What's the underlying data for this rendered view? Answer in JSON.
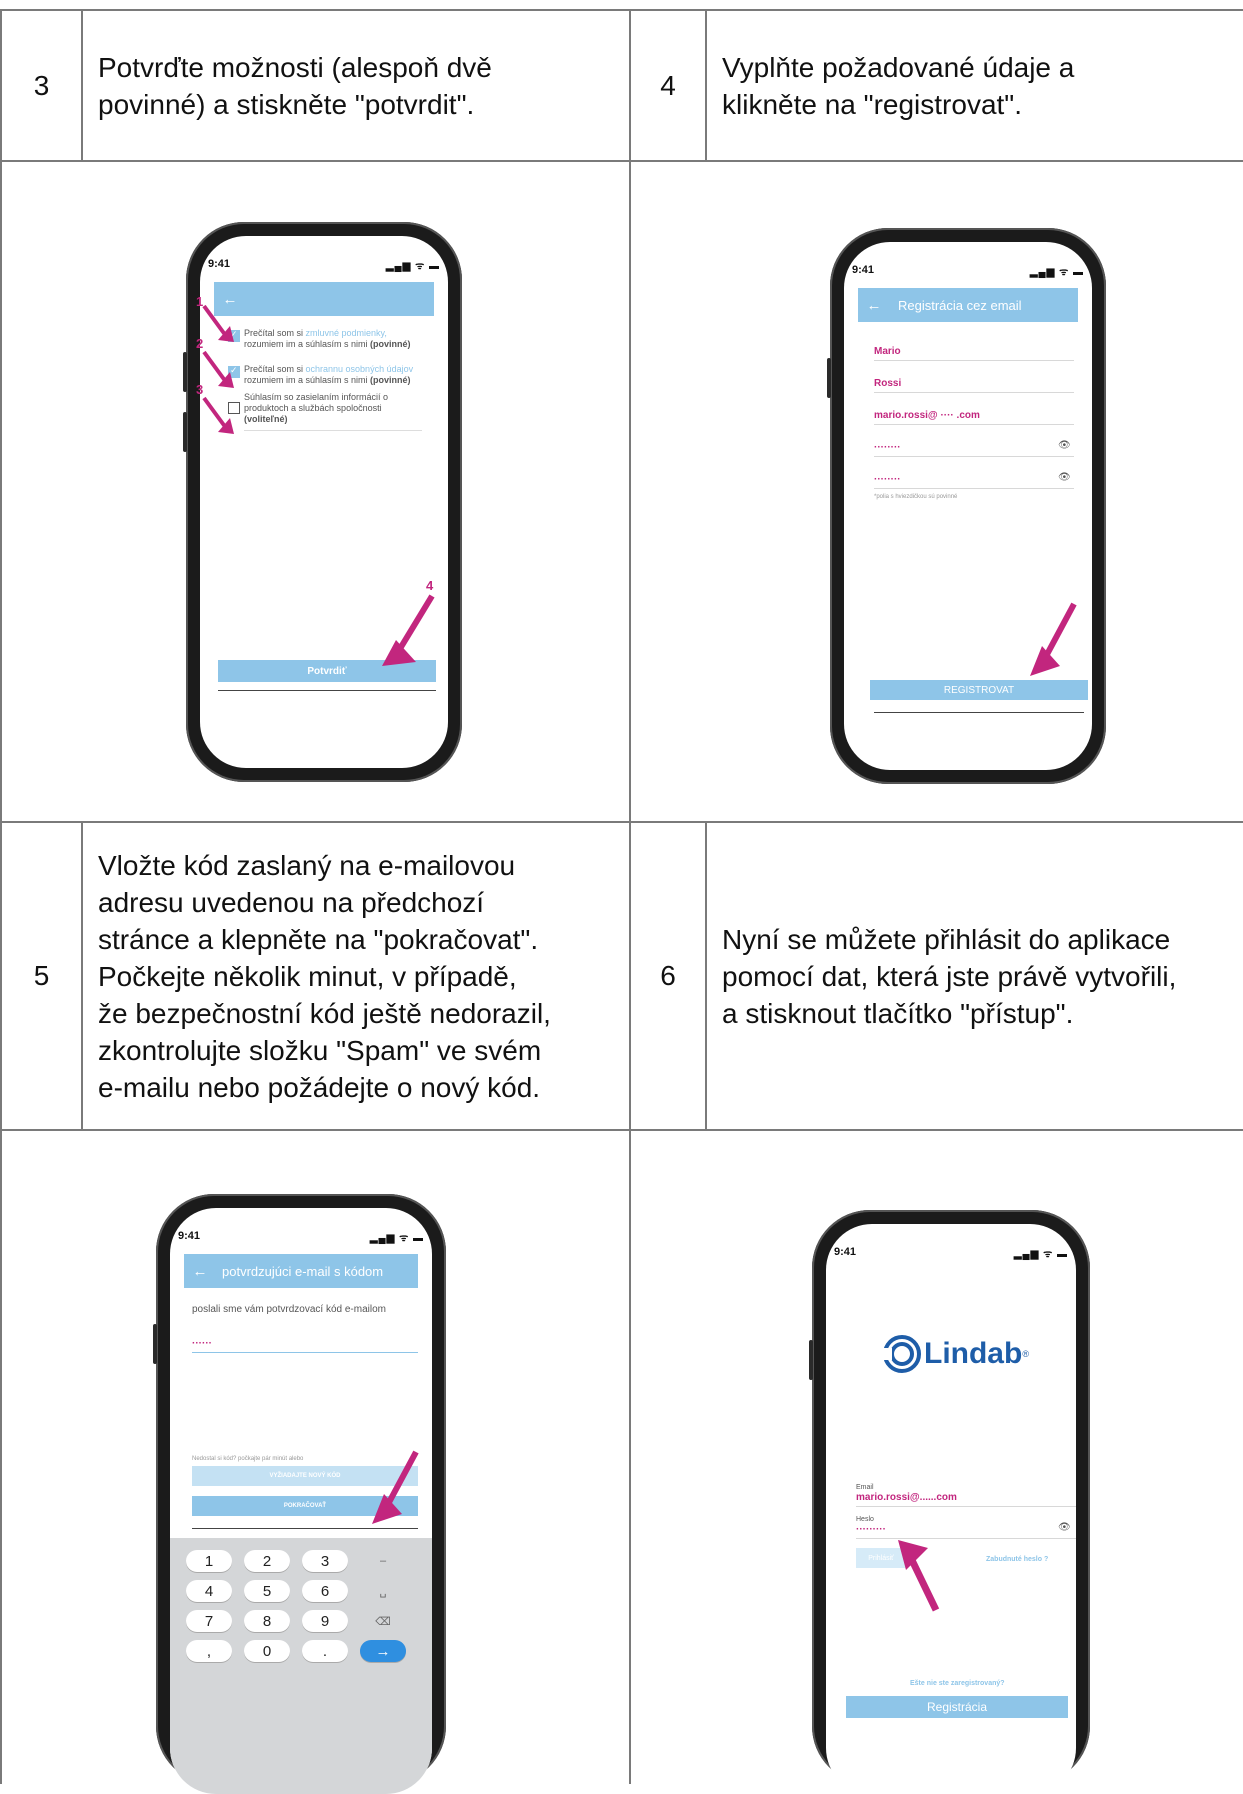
{
  "steps": [
    {
      "num": "3",
      "text": "Potvrďte možnosti (alespoň dvě\npovinné) a stiskněte \"potvrdit\"."
    },
    {
      "num": "4",
      "text": "Vyplňte požadované údaje a\nklikněte na \"registrovat\"."
    },
    {
      "num": "5",
      "text": "Vložte kód zaslaný na e-mailovou\nadresu uvedenou na předchozí\nstránce a klepněte na \"pokračovat\".\nPočkejte několik minut, v případě,\nže bezpečnostní kód ještě nedorazil,\nzkontrolujte složku \"Spam\" ve svém\ne-mailu nebo požádejte o nový kód."
    },
    {
      "num": "6",
      "text": "Nyní se můžete přihlásit do aplikace\npomocí dat, která jste právě vytvořili,\na stisknout tlačítko \"přístup\"."
    }
  ],
  "status": {
    "time": "9:41",
    "signal": "▂▄▆ ᯤ ▬"
  },
  "phone3": {
    "markers": [
      "1",
      "2",
      "3",
      "4"
    ],
    "opt1_a": "Prečítal som si ",
    "opt1_link": "zmluvné podmienky,",
    "opt1_b": "rozumiem im a súhlasím s nimi ",
    "opt1_req": "(povinné)",
    "opt2_a": "Prečítal som si ",
    "opt2_link": "ochrannu osobných údajov",
    "opt2_b": "rozumiem im a súhlasím s nimi ",
    "opt2_req": "(povinné)",
    "opt3_a": "Súhlasím so zasielaním informácií o",
    "opt3_b": "produktoch a službách spoločnosti",
    "opt3_opt": "(voliteľné)",
    "button": "Potvrdiť"
  },
  "phone4": {
    "title": "Registrácia cez email",
    "first": "Mario",
    "last": "Rossi",
    "email": "mario.rossi@ ···· .com",
    "pwd1": "········",
    "pwd2": "········",
    "note": "*polia s hviezdičkou sú povinné",
    "button": "REGISTROVAT"
  },
  "phone5": {
    "title": "potvrdzujúci e-mail s kódom",
    "info": "poslali sme vám potvrdzovací kód e-mailom",
    "code": "······",
    "hint": "Nedostal si kód? počkajte pár minút alebo",
    "resend": "VYŽIADAJTE NOVÝ KÓD",
    "continue": "POKRAČOVAŤ",
    "keys": [
      "1",
      "2",
      "3",
      "–",
      "4",
      "5",
      "6",
      "␣",
      "7",
      "8",
      "9",
      "⌫",
      ",",
      "0",
      ".",
      "→"
    ]
  },
  "phone6": {
    "logo": "Lindab",
    "logo_mark": "®",
    "email_label": "Email",
    "email_value": "mario.rossi@......com",
    "pwd_label": "Heslo",
    "pwd_value": "·········",
    "login": "Prihlásiť",
    "forgot": "Zabudnuté heslo ?",
    "not_registered": "Ešte nie ste zaregistrovaný?",
    "register": "Registrácia"
  }
}
